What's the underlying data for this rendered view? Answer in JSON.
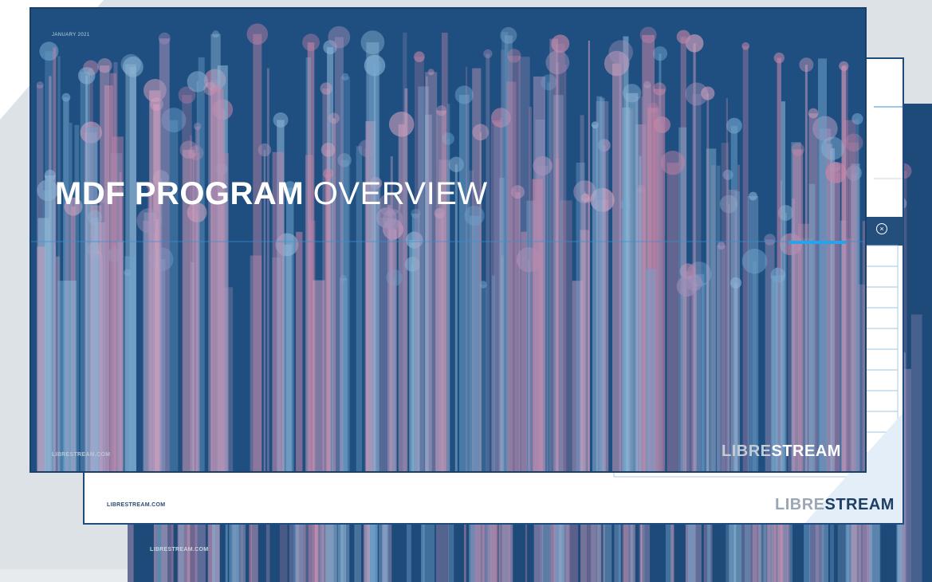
{
  "slides": {
    "front": {
      "date": "JANUARY 2021",
      "title_strong": "MDF PROGRAM",
      "title_light": " OVERVIEW",
      "url": "LIBRESTREAM.COM",
      "logo_a": "LIBRE",
      "logo_b": "STREAM"
    },
    "middle": {
      "url": "LIBRESTREAM.COM",
      "logo_a": "LIBRE",
      "logo_b": "STREAM",
      "close_symbol": "×"
    },
    "back": {
      "url": "LIBRESTREAM.COM"
    }
  },
  "colors": {
    "page_bg": "#e8ebee",
    "slide_blue": "#1e4f80",
    "accent_blue": "#2a9ee0",
    "pink": "#c886a8"
  }
}
